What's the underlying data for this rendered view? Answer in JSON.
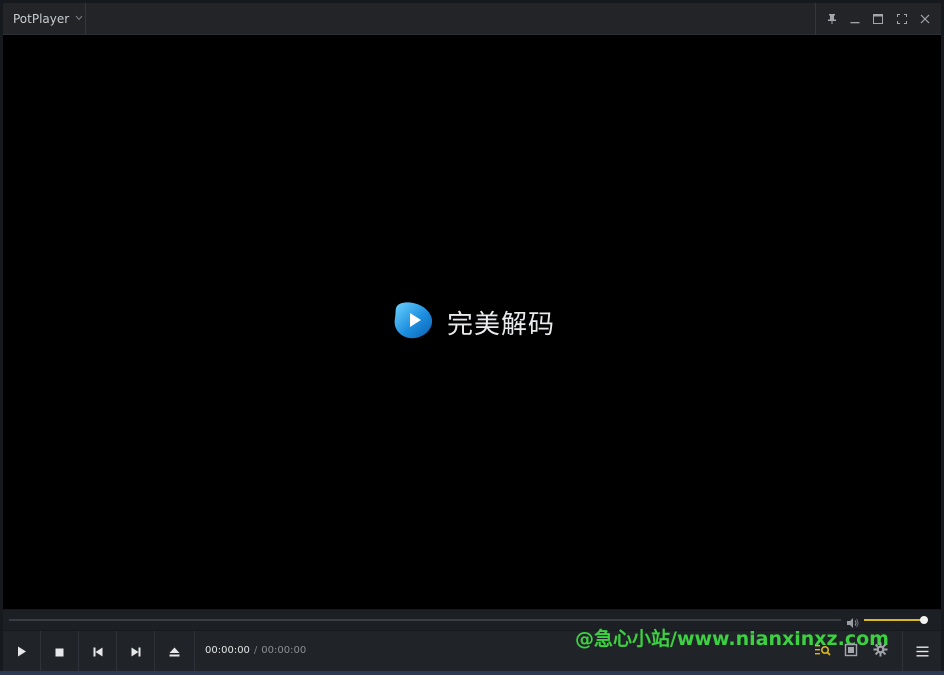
{
  "app": {
    "title": "PotPlayer"
  },
  "video": {
    "logo_text": "完美解码"
  },
  "playback": {
    "current_time": "00:00:00",
    "separator": "/",
    "duration": "00:00:00",
    "progress": 0
  },
  "volume": {
    "level": 1.0
  },
  "watermark": {
    "text": "@急心小站/www.nianxinxz.com"
  },
  "colors": {
    "accent": "#d8b823",
    "watermark": "#3bd140",
    "background": "#000000"
  },
  "icons": {
    "title_controls": [
      "pin-icon",
      "minimize-icon",
      "maximize-icon",
      "fullscreen-icon",
      "close-icon"
    ],
    "transport": [
      "play-icon",
      "stop-icon",
      "previous-icon",
      "next-icon",
      "eject-icon"
    ],
    "right": [
      "playlist-search-icon",
      "panel-icon",
      "settings-icon",
      "menu-icon"
    ]
  }
}
